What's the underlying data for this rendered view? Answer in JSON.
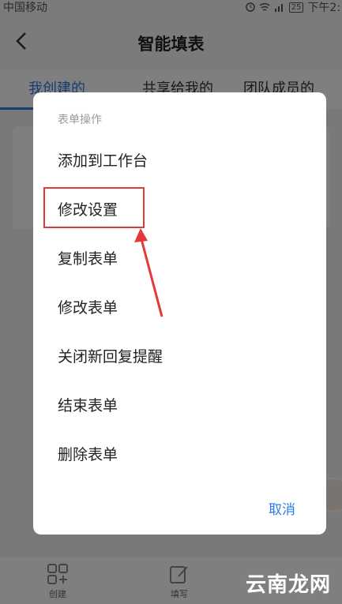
{
  "status_bar": {
    "carrier": "中国移动",
    "battery": "25",
    "time": "下午2:"
  },
  "header": {
    "title": "智能填表"
  },
  "tabs": [
    {
      "label": "我创建的"
    },
    {
      "label": "共享给我的"
    },
    {
      "label": "团队成员的"
    }
  ],
  "dialog": {
    "title": "表单操作",
    "items": [
      {
        "label": "添加到工作台"
      },
      {
        "label": "修改设置"
      },
      {
        "label": "复制表单"
      },
      {
        "label": "修改表单"
      },
      {
        "label": "关闭新回复提醒"
      },
      {
        "label": "结束表单"
      },
      {
        "label": "删除表单"
      }
    ],
    "cancel_label": "取消"
  },
  "bottom_nav": [
    {
      "label": "创建",
      "icon": "grid-plus-icon"
    },
    {
      "label": "填写",
      "icon": "edit-icon"
    }
  ],
  "annotation": {
    "highlighted_item": "修改设置",
    "color": "#e03a3a"
  },
  "watermark": "云南龙网",
  "colors": {
    "accent": "#2a7de1",
    "highlight": "#e03a3a"
  }
}
